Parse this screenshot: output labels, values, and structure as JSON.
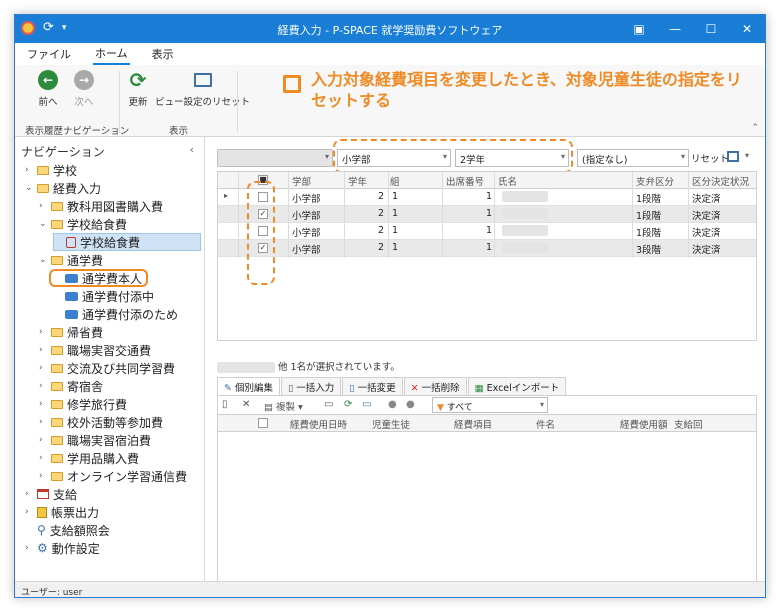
{
  "window": {
    "title": "経費入力 - P-SPACE 就学奨励費ソフトウェア",
    "controls": [
      "▣",
      "—",
      "☐",
      "✕"
    ]
  },
  "menu": {
    "tabs": [
      "ファイル",
      "ホーム",
      "表示"
    ]
  },
  "ribbon": {
    "back_label": "前へ",
    "next_label": "次へ",
    "refresh_label": "更新",
    "view_reset_label": "ビュー設定のリセット",
    "group_history": "表示履歴ナビゲーション",
    "group_view": "表示"
  },
  "callout": {
    "text": "入力対象経費項目を変更したとき、対象児童生徒の指定をリセットする"
  },
  "nav": {
    "header": "ナビゲーション",
    "collapse": "‹",
    "items": [
      {
        "label": "学校",
        "level": 0,
        "arrow": "›",
        "icon": "folder"
      },
      {
        "label": "経費入力",
        "level": 0,
        "arrow": "⌄",
        "icon": "folder"
      },
      {
        "label": "教科用図書購入費",
        "level": 1,
        "arrow": "›",
        "icon": "folder"
      },
      {
        "label": "学校給食費",
        "level": 1,
        "arrow": "⌄",
        "icon": "folder"
      },
      {
        "label": "学校給食費",
        "level": 2,
        "arrow": "",
        "icon": "doc"
      },
      {
        "label": "通学費",
        "level": 1,
        "arrow": "⌄",
        "icon": "folder"
      },
      {
        "label": "通学費本人",
        "level": 2,
        "arrow": "",
        "icon": "bus"
      },
      {
        "label": "通学費付添中",
        "level": 2,
        "arrow": "",
        "icon": "bus"
      },
      {
        "label": "通学費付添のため",
        "level": 2,
        "arrow": "",
        "icon": "bus"
      },
      {
        "label": "帰省費",
        "level": 1,
        "arrow": "›",
        "icon": "folder"
      },
      {
        "label": "職場実習交通費",
        "level": 1,
        "arrow": "›",
        "icon": "folder"
      },
      {
        "label": "交流及び共同学習費",
        "level": 1,
        "arrow": "›",
        "icon": "folder"
      },
      {
        "label": "寄宿舎",
        "level": 1,
        "arrow": "›",
        "icon": "folder"
      },
      {
        "label": "修学旅行費",
        "level": 1,
        "arrow": "›",
        "icon": "folder"
      },
      {
        "label": "校外活動等参加費",
        "level": 1,
        "arrow": "›",
        "icon": "folder"
      },
      {
        "label": "職場実習宿泊費",
        "level": 1,
        "arrow": "›",
        "icon": "folder"
      },
      {
        "label": "学用品購入費",
        "level": 1,
        "arrow": "›",
        "icon": "folder"
      },
      {
        "label": "オンライン学習通信費",
        "level": 1,
        "arrow": "›",
        "icon": "folder"
      },
      {
        "label": "支給",
        "level": 0,
        "arrow": "›",
        "icon": "calendar"
      },
      {
        "label": "帳票出力",
        "level": 0,
        "arrow": "›",
        "icon": "report"
      },
      {
        "label": "支給額照会",
        "level": 0,
        "arrow": "",
        "icon": "search"
      },
      {
        "label": "動作設定",
        "level": 0,
        "arrow": "›",
        "icon": "gear"
      }
    ]
  },
  "filters": {
    "department": "小学部",
    "grade": "2学年",
    "other": "(指定なし)",
    "reset_label": "リセット"
  },
  "grid": {
    "columns": [
      "学部",
      "学年",
      "組",
      "出席番号",
      "氏名",
      "支弁区分",
      "区分決定状況"
    ],
    "rows": [
      {
        "dept": "小学部",
        "grade": "2",
        "cls": "1",
        "num": "1",
        "kubun": "1段階",
        "status": "決定済",
        "checked": false
      },
      {
        "dept": "小学部",
        "grade": "2",
        "cls": "1",
        "num": "1",
        "kubun": "1段階",
        "status": "決定済",
        "checked": true
      },
      {
        "dept": "小学部",
        "grade": "2",
        "cls": "1",
        "num": "1",
        "kubun": "1段階",
        "status": "決定済",
        "checked": false
      },
      {
        "dept": "小学部",
        "grade": "2",
        "cls": "1",
        "num": "1",
        "kubun": "3段階",
        "status": "決定済",
        "checked": true
      }
    ]
  },
  "selection_info": "他 1名が選択されています。",
  "subtabs": [
    "個別編集",
    "一括入力",
    "一括変更",
    "一括削除",
    "Excelインポート"
  ],
  "subtoolbar": {
    "copy_label": "複製",
    "filter_value": "すべて"
  },
  "subgrid": {
    "columns": [
      "経費使用日時",
      "児童生徒",
      "経費項目",
      "件名",
      "経費使用額",
      "支給回"
    ]
  },
  "status": {
    "user": "ユーザー: user"
  },
  "colors": {
    "accent": "#1a7ed6",
    "callout": "#f08a24"
  }
}
